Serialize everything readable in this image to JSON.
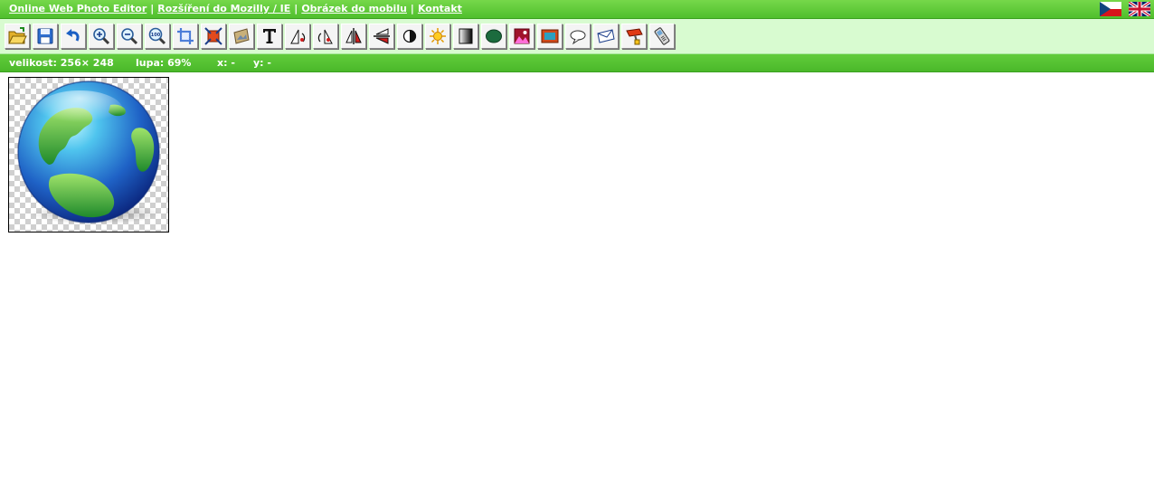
{
  "nav": {
    "links": [
      "Online Web Photo Editor",
      "Rozšíření do Mozilly / IE",
      "Obrázek do mobilu",
      "Kontakt"
    ],
    "separator": "|"
  },
  "flags": [
    "cz-flag-icon",
    "uk-flag-icon"
  ],
  "toolbar": {
    "tools": [
      "open-folder-icon",
      "save-icon",
      "undo-icon",
      "zoom-in-icon",
      "zoom-out-icon",
      "zoom-100-icon",
      "crop-icon",
      "resize-icon",
      "image-icon",
      "text-icon",
      "rotate-left-icon",
      "rotate-right-icon",
      "flip-vertical-icon",
      "flip-horizontal-icon",
      "contrast-icon",
      "brightness-icon",
      "grayscale-icon",
      "ellipse-icon",
      "photo-effect-icon",
      "frame-icon",
      "speech-bubble-icon",
      "envelope-icon",
      "paint-roller-icon",
      "mobile-phone-icon"
    ]
  },
  "status": {
    "size": "velikost: 256× 248",
    "zoom": "lupa: 69%",
    "x": "x: -",
    "y": "y: -"
  },
  "colors": {
    "bar_green": "#4fbf2d",
    "toolbar_bg": "#d8fbd0"
  },
  "canvas": {
    "image": "earth-globe-icon"
  }
}
